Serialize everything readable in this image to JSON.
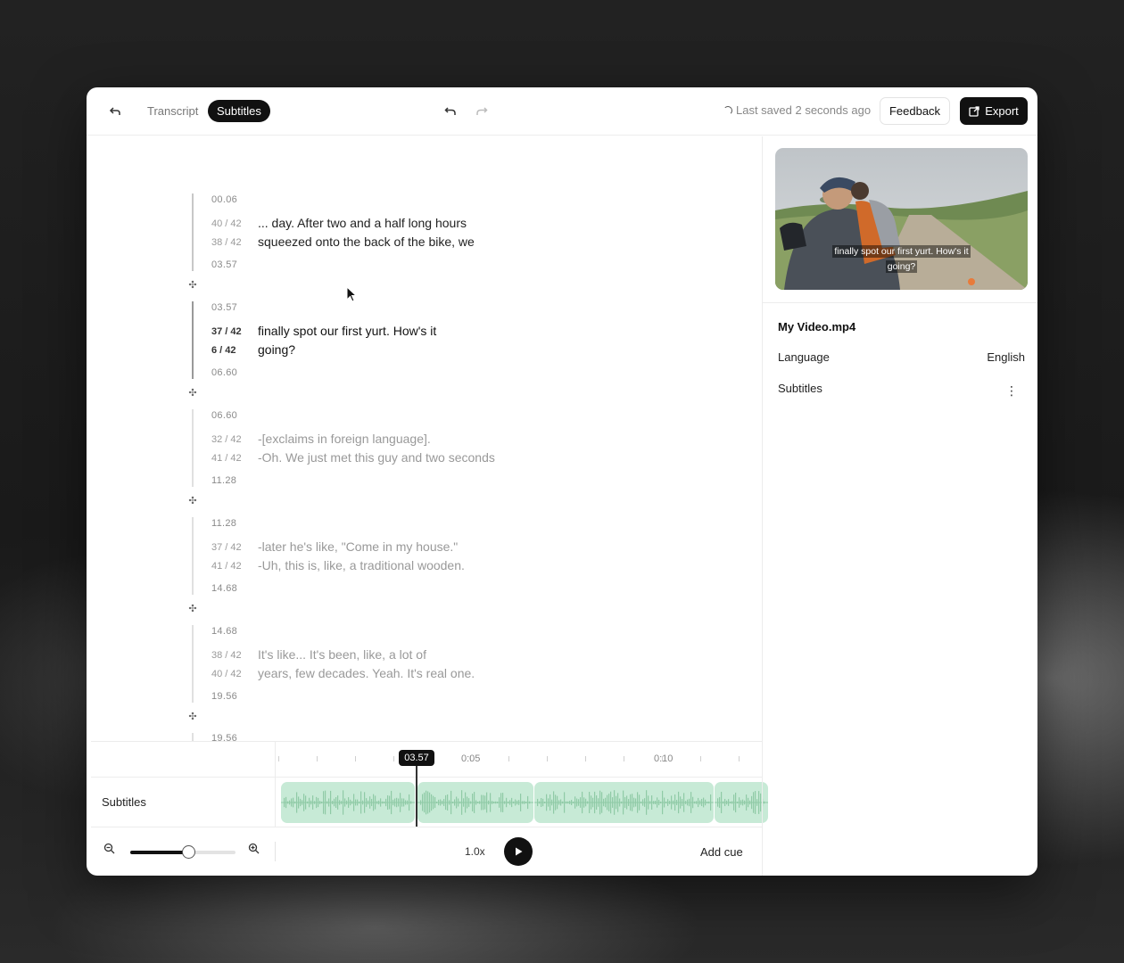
{
  "header": {
    "back_icon": "back-arrow-icon",
    "tabs": [
      "Transcript",
      "Subtitles"
    ],
    "active_tab": "Subtitles",
    "saved_status": "Last saved 2 seconds ago",
    "feedback_label": "Feedback",
    "export_label": "Export"
  },
  "cues": [
    {
      "start": "00.06",
      "end": "03.57",
      "lines": [
        {
          "count": "40 / 42",
          "text": "... day. After two and a half long hours"
        },
        {
          "count": "38 / 42",
          "text": "squeezed onto the back of the bike, we"
        }
      ]
    },
    {
      "start": "03.57",
      "end": "06.60",
      "lines": [
        {
          "count": "37 / 42",
          "text": "finally spot our first yurt. How's it"
        },
        {
          "count": "6 / 42",
          "text": "going?"
        }
      ]
    },
    {
      "start": "06.60",
      "end": "11.28",
      "lines": [
        {
          "count": "32 / 42",
          "text": "-[exclaims in foreign language]."
        },
        {
          "count": "41 / 42",
          "text": "-Oh. We just met this guy and two seconds"
        }
      ]
    },
    {
      "start": "11.28",
      "end": "14.68",
      "lines": [
        {
          "count": "37 / 42",
          "text": "-later he's like, \"Come in my house.\""
        },
        {
          "count": "41 / 42",
          "text": "-Uh, this is, like, a traditional wooden."
        }
      ]
    },
    {
      "start": "14.68",
      "end": "19.56",
      "lines": [
        {
          "count": "38 / 42",
          "text": "It's like... It's been, like, a lot of"
        },
        {
          "count": "40 / 42",
          "text": "years, few decades. Yeah. It's real one."
        }
      ]
    },
    {
      "start": "19.56"
    }
  ],
  "timeline": {
    "playhead_time": "03.57",
    "tick_labels": [
      "0:05",
      "0:10"
    ],
    "track_label": "Subtitles",
    "zoom_level": 0.55,
    "speed": "1.0x",
    "add_cue_label": "Add cue"
  },
  "panel": {
    "caption_lines": [
      "finally spot our first yurt. How's it",
      "going?"
    ],
    "file_name": "My Video.mp4",
    "language_label": "Language",
    "language_value": "English",
    "subtitles_label": "Subtitles"
  },
  "colors": {
    "accent": "#111111",
    "waveform_bg": "#c7ead6",
    "waveform": "#8fcaa6"
  }
}
